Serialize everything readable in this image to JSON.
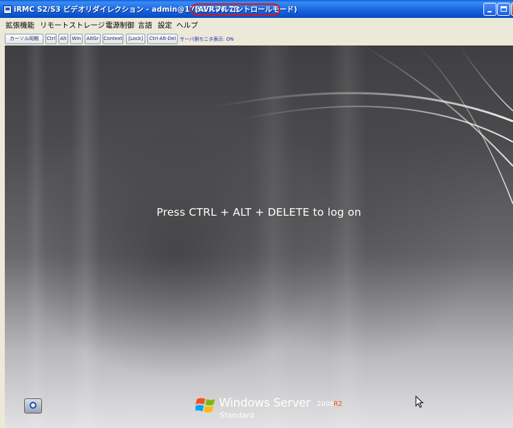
{
  "window": {
    "title": "iRMC S2/S3 ビデオリダイレクション - admin@172.17.46.78",
    "mode": "(AVRフルコントロールモード)",
    "highlight_color": "#e01414",
    "titlebar_color": "#1f6ee8"
  },
  "menu": {
    "items": [
      "拡張機能",
      "リモートストレージ",
      "電源制御",
      "言語",
      "設定",
      "ヘルプ"
    ]
  },
  "toolbar": {
    "buttons": [
      "カーソル同期",
      "Ctrl",
      "Alt",
      "Win",
      "AltGr",
      "Context",
      "[Lock]",
      "Ctrl-Alt-Del"
    ],
    "status": "サーバ側モニタ表示: ON"
  },
  "desktop": {
    "logon_message": "Press CTRL + ALT + DELETE to log on",
    "accessibility_icon": "ease-of-access-icon",
    "brand": {
      "name": "Windows Server",
      "version": "2008",
      "release": "R2",
      "edition": "Standard",
      "release_color": "#f05a1a"
    }
  }
}
